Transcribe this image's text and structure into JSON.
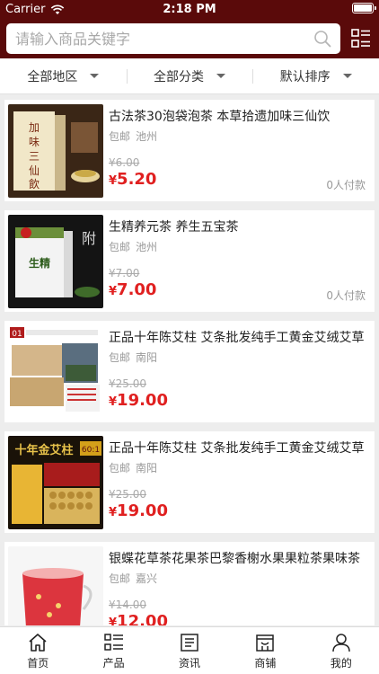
{
  "status_bar": {
    "carrier": "Carrier",
    "time": "2:18 PM"
  },
  "search": {
    "placeholder": "请输入商品关键字"
  },
  "filters": [
    {
      "label": "全部地区"
    },
    {
      "label": "全部分类"
    },
    {
      "label": "默认排序"
    }
  ],
  "products": [
    {
      "title": "古法茶30泡袋泡茶 本草拾遗加味三仙饮",
      "shipping": "包邮",
      "location": "池州",
      "old_price": "¥6.00",
      "currency": "¥",
      "price": "5.20",
      "paid": "0人付款",
      "thumb_text": "加味三仙飲"
    },
    {
      "title": "生精养元茶 养生五宝茶",
      "shipping": "包邮",
      "location": "池州",
      "old_price": "¥7.00",
      "currency": "¥",
      "price": "7.00",
      "paid": "0人付款",
      "thumb_text": "生精"
    },
    {
      "title": "正品十年陈艾柱 艾条批发纯手工黄金艾绒艾草",
      "shipping": "包邮",
      "location": "南阳",
      "old_price": "¥25.00",
      "currency": "¥",
      "price": "19.00",
      "paid": "",
      "thumb_text": "01"
    },
    {
      "title": "正品十年陈艾柱 艾条批发纯手工黄金艾绒艾草",
      "shipping": "包邮",
      "location": "南阳",
      "old_price": "¥25.00",
      "currency": "¥",
      "price": "19.00",
      "paid": "",
      "thumb_text": "十年金艾柱"
    },
    {
      "title": "银蝶花草茶花果茶巴黎香榭水果果粒茶果味茶",
      "shipping": "包邮",
      "location": "嘉兴",
      "old_price": "¥14.00",
      "currency": "¥",
      "price": "12.00",
      "paid": "",
      "thumb_text": ""
    }
  ],
  "tabs": [
    {
      "label": "首页",
      "icon": "home-icon"
    },
    {
      "label": "产品",
      "icon": "list-icon"
    },
    {
      "label": "资讯",
      "icon": "news-icon"
    },
    {
      "label": "商铺",
      "icon": "shop-icon"
    },
    {
      "label": "我的",
      "icon": "user-icon"
    }
  ],
  "colors": {
    "header": "#5a0a0a",
    "price": "#e02020",
    "background": "#ededed"
  }
}
